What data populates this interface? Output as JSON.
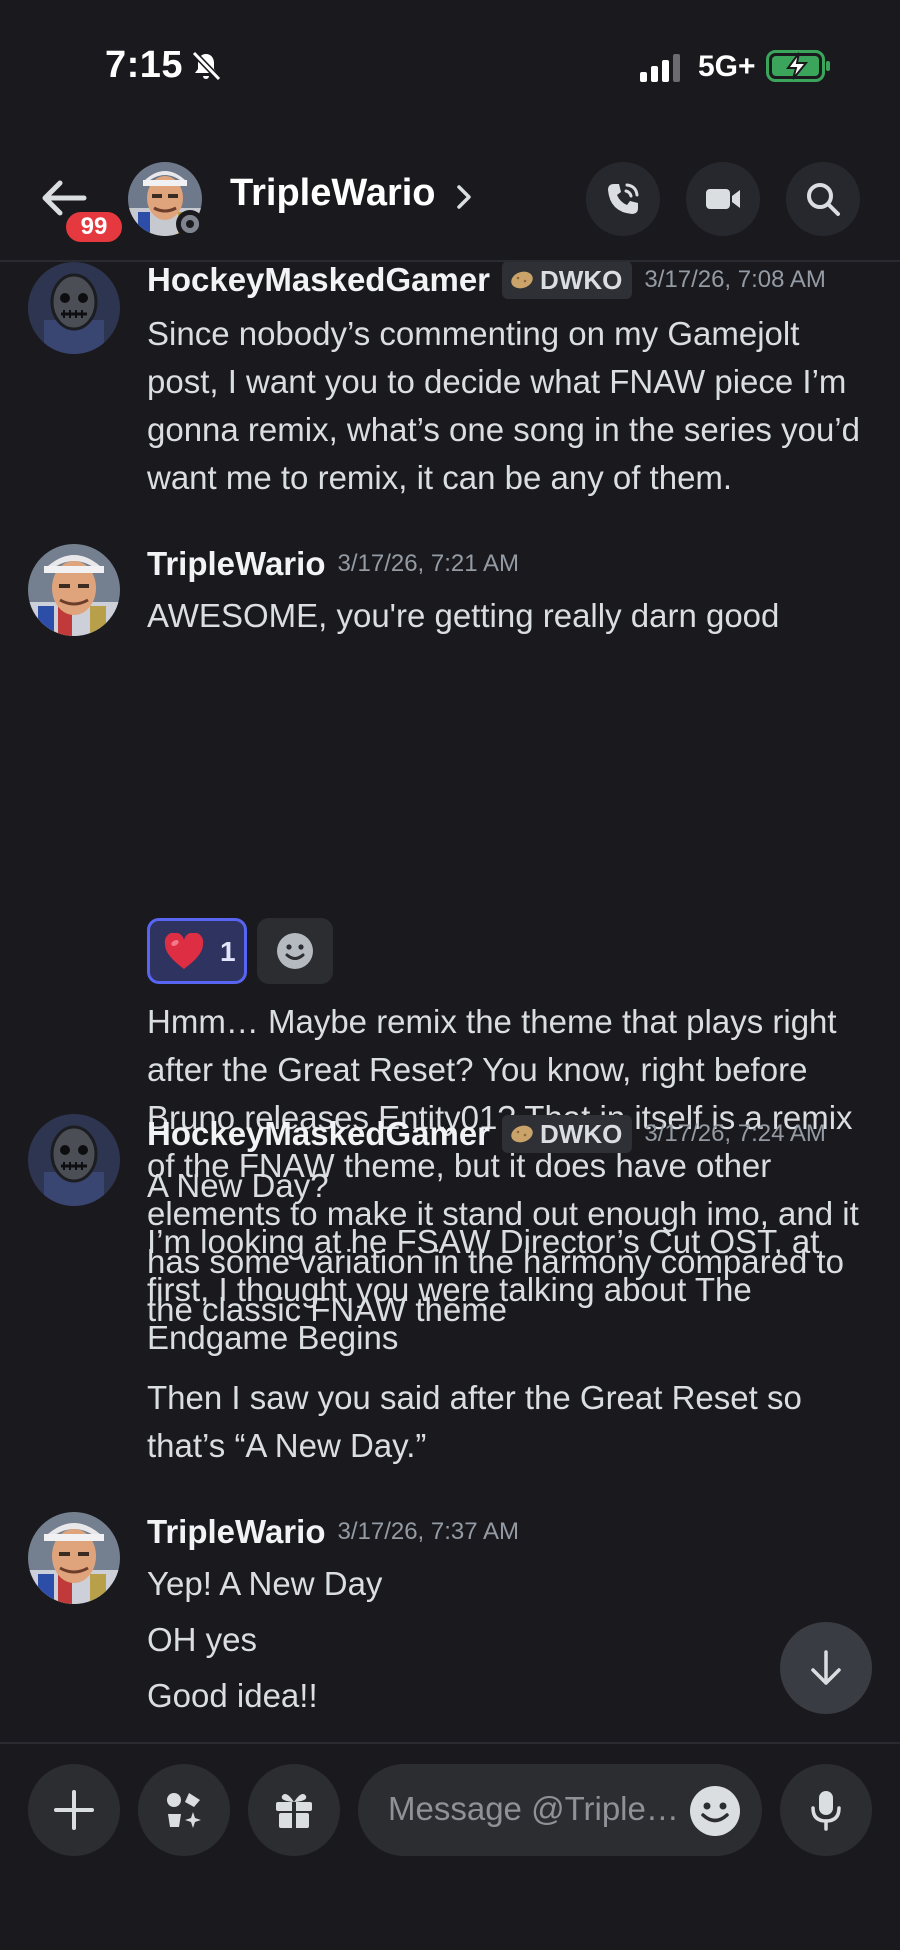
{
  "status": {
    "time": "7:15",
    "network": "5G+"
  },
  "header": {
    "title": "TripleWario",
    "unread_count": "99"
  },
  "messages": [
    {
      "author": "HockeyMaskedGamer",
      "tag": "DWKO",
      "timestamp": "3/17/26, 7:08 AM",
      "lines": [
        "Since nobody’s commenting on my Gamejolt post, I want you to decide what FNAW piece I’m gonna remix, what’s one song in the series you’d want me to remix, it can be any of them."
      ]
    },
    {
      "author": "TripleWario",
      "timestamp": "3/17/26, 7:21 AM",
      "lines": [
        "AWESOME, you're getting really darn good",
        "Hmm… Maybe remix the theme that plays right after the Great Reset? You know, right before Bruno releases Entity01? That in itself is a remix of the FNAW theme, but it does have other elements to make it stand out enough imo, and it has some variation in the harmony compared to the classic FNAW theme"
      ],
      "reaction": {
        "emoji": "heart",
        "count": "1"
      }
    },
    {
      "author": "HockeyMaskedGamer",
      "tag": "DWKO",
      "timestamp": "3/17/26, 7:24 AM",
      "lines": [
        "A New Day?",
        "I’m looking at he FSAW Director’s Cut OST, at first, I thought you were talking about The Endgame Begins",
        "Then I saw you said after the Great Reset so that’s “A New Day.”"
      ]
    },
    {
      "author": "TripleWario",
      "timestamp": "3/17/26, 7:37 AM",
      "lines": [
        "Yep! A New Day",
        "OH yes",
        "Good idea!!"
      ]
    }
  ],
  "composer": {
    "placeholder": "Message @Triple…"
  },
  "colors": {
    "background": "#1a1a1e",
    "accent": "#5865f2",
    "badge": "#e5393f",
    "battery": "#3ba55c"
  }
}
